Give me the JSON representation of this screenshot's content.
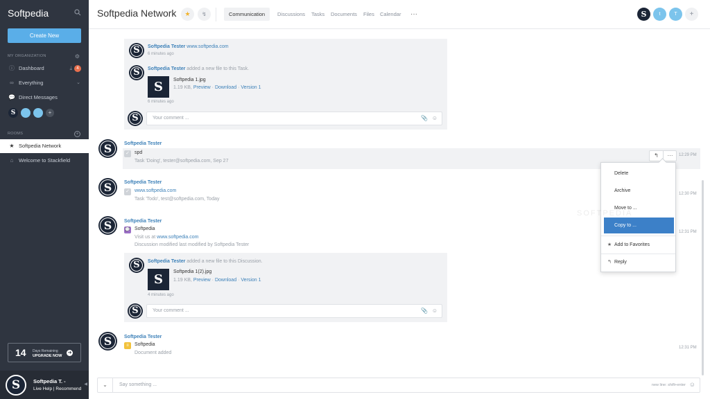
{
  "sidebar": {
    "brand": "Softpedia",
    "create_button": "Create New",
    "org_section": "MY ORGANIZATION",
    "items": [
      {
        "label": "Dashboard",
        "icon": "info-icon",
        "badge": "4"
      },
      {
        "label": "Everything",
        "icon": "infinity-icon"
      },
      {
        "label": "Direct Messages",
        "icon": "chat-icon"
      }
    ],
    "rooms_section": "ROOMS",
    "rooms": [
      {
        "label": "Softpedia Network",
        "icon": "star-icon",
        "active": true
      },
      {
        "label": "Welcome to Stackfield",
        "icon": "inbox-icon",
        "active": false
      }
    ],
    "trial": {
      "days": "14",
      "remaining": "Days Remaining",
      "upgrade": "UPGRADE NOW"
    },
    "user": {
      "name": "Softpedia T. -",
      "links": "Live Help | Recommend"
    }
  },
  "topbar": {
    "title": "Softpedia Network",
    "tabs": [
      "Communication",
      "Discussions",
      "Tasks",
      "Documents",
      "Files",
      "Calendar"
    ],
    "active_tab": "Communication",
    "members": [
      {
        "initial": "S",
        "color": "#1b2536"
      },
      {
        "initial": "t",
        "color": "#7cc4ec"
      },
      {
        "initial": "T",
        "color": "#7cc4ec"
      }
    ]
  },
  "feed": {
    "thread1": {
      "post1": {
        "author": "Softpedia Tester",
        "text": "www.softpedia.com",
        "time": "6 minutes ago"
      },
      "post2": {
        "author": "Softpedia Tester",
        "action": "added a new file to this Task.",
        "file_name": "Softpedia 1.jpg",
        "file_size": "1.19 KB",
        "preview": "Preview",
        "download": "Download",
        "version": "Version 1",
        "time": "6 minutes ago"
      },
      "comment_placeholder": "Your comment ..."
    },
    "msg1": {
      "author": "Softpedia Tester",
      "title": "spd",
      "meta": "Task 'Doing', tester@softpedia.com, Sep 27",
      "time": "12:29 PM"
    },
    "msg2": {
      "author": "Softpedia Tester",
      "title": "www.softpedia.com",
      "meta": "Task 'Todo', test@softpedia.com, Today",
      "time": "12:30 PM"
    },
    "msg3": {
      "author": "Softpedia Tester",
      "title": "Softpedia",
      "visit_prefix": "Visit us at",
      "visit_link": "www.softpedia.com",
      "meta": "Discussion modified last modified by Softpedia Tester",
      "time": "12:31 PM",
      "file_post": {
        "author": "Softpedia Tester",
        "action": "added a new file to this Discussion.",
        "file_name": "Softpedia 1(2).jpg",
        "file_size": "1.19 KB",
        "preview": "Preview",
        "download": "Download",
        "version": "Version 1",
        "time": "4 minutes ago"
      },
      "comment_placeholder": "Your comment ..."
    },
    "msg4": {
      "author": "Softpedia Tester",
      "title": "Softpedia",
      "meta": "Document added",
      "time": "12:31 PM"
    }
  },
  "context_menu": {
    "items": [
      "Delete",
      "Archive",
      "Move to ...",
      "Copy to ..."
    ],
    "favorites": "Add to Favorites",
    "reply": "Reply"
  },
  "watermark": "SOFTPEDIA",
  "compose": {
    "placeholder": "Say something ...",
    "hint": "new line: shift+enter"
  },
  "colors": {
    "sidebar": "#2f3540",
    "accent": "#5aaee8",
    "link": "#3c80b8",
    "highlight": "#3c80c8",
    "badge": "#e8704e"
  }
}
